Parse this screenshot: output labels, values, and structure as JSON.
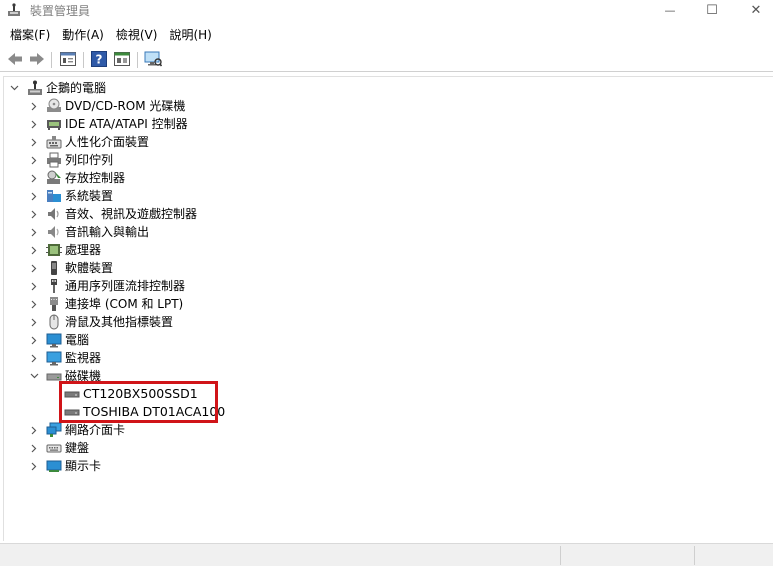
{
  "window": {
    "title": "裝置管理員",
    "minimize_glyph": "—",
    "maximize_glyph": "☐",
    "close_glyph": "✕"
  },
  "menu": [
    "檔案(F)",
    "動作(A)",
    "檢視(V)",
    "說明(H)"
  ],
  "toolbar": {
    "buttons": [
      "back-arrow-icon",
      "forward-arrow-icon",
      "properties-icon",
      "help-icon",
      "update-driver-icon",
      "scan-hardware-icon"
    ]
  },
  "tree": {
    "root": {
      "label": "企鵝的電腦",
      "icon": "computer-icon",
      "expanded": true
    },
    "categories": [
      {
        "label": "DVD/CD-ROM 光碟機",
        "icon": "dvd-drive-icon"
      },
      {
        "label": "IDE ATA/ATAPI 控制器",
        "icon": "ide-controller-icon"
      },
      {
        "label": "人性化介面裝置",
        "icon": "hid-icon"
      },
      {
        "label": "列印佇列",
        "icon": "printer-icon"
      },
      {
        "label": "存放控制器",
        "icon": "storage-controller-icon"
      },
      {
        "label": "系統裝置",
        "icon": "system-device-icon"
      },
      {
        "label": "音效、視訊及遊戲控制器",
        "icon": "speaker-icon"
      },
      {
        "label": "音訊輸入與輸出",
        "icon": "audio-io-icon"
      },
      {
        "label": "處理器",
        "icon": "processor-icon"
      },
      {
        "label": "軟體裝置",
        "icon": "software-device-icon"
      },
      {
        "label": "通用序列匯流排控制器",
        "icon": "usb-icon"
      },
      {
        "label": "連接埠 (COM 和 LPT)",
        "icon": "port-icon"
      },
      {
        "label": "滑鼠及其他指標裝置",
        "icon": "mouse-icon"
      },
      {
        "label": "電腦",
        "icon": "monitor-icon"
      },
      {
        "label": "監視器",
        "icon": "monitor-icon"
      },
      {
        "label": "磁碟機",
        "icon": "disk-drive-icon",
        "expanded": true,
        "children": [
          {
            "label": "CT120BX500SSD1",
            "icon": "disk-drive-icon"
          },
          {
            "label": "TOSHIBA DT01ACA100",
            "icon": "disk-drive-icon"
          }
        ]
      },
      {
        "label": "網路介面卡",
        "icon": "network-adapter-icon"
      },
      {
        "label": "鍵盤",
        "icon": "keyboard-icon"
      },
      {
        "label": "顯示卡",
        "icon": "display-adapter-icon"
      }
    ]
  },
  "colors": {
    "highlight_border": "#d01418",
    "chevron": "#555555",
    "status_bar": "#f0f0f0"
  }
}
